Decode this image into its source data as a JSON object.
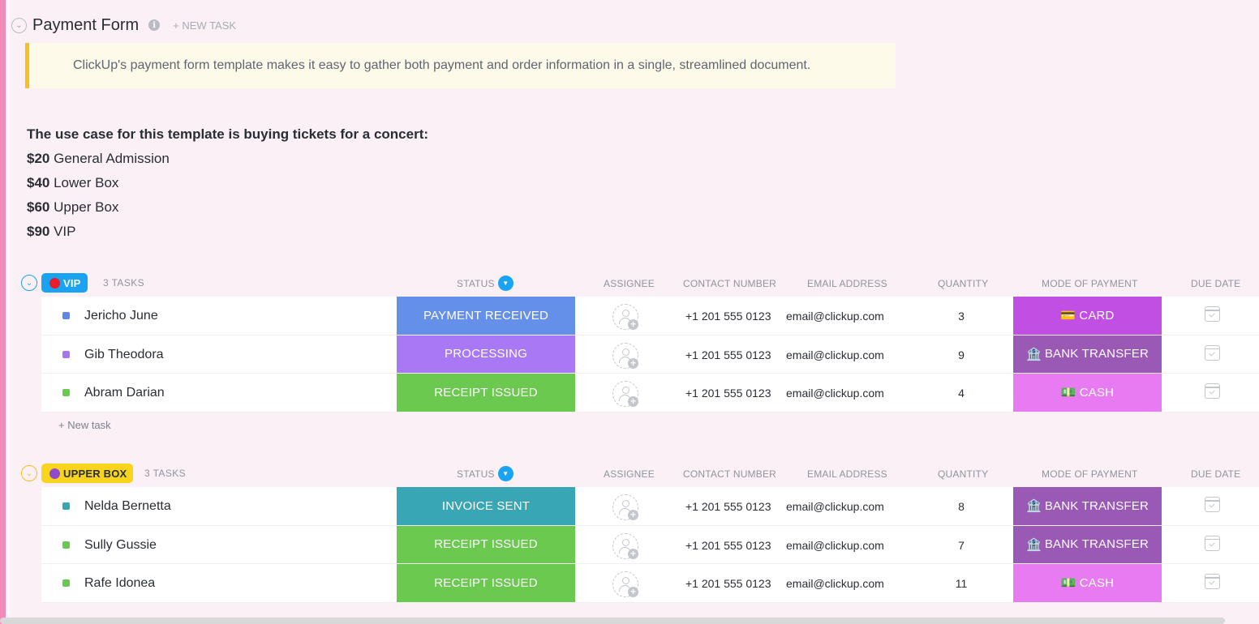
{
  "header": {
    "title": "Payment Form",
    "new_task": "+ NEW TASK"
  },
  "banner": {
    "text": "ClickUp's payment form template makes it easy to gather both payment and order information in a single, streamlined document."
  },
  "description": {
    "heading": "The use case for this template is buying tickets for a concert:",
    "items": [
      {
        "price": "$20",
        "label": " General Admission"
      },
      {
        "price": "$40",
        "label": " Lower Box"
      },
      {
        "price": "$60",
        "label": " Upper Box"
      },
      {
        "price": "$90",
        "label": " VIP"
      }
    ]
  },
  "columns": {
    "status": "STATUS",
    "assignee": "ASSIGNEE",
    "contact": "CONTACT NUMBER",
    "email": "EMAIL ADDRESS",
    "quantity": "QUANTITY",
    "payment": "MODE OF PAYMENT",
    "due": "DUE DATE"
  },
  "groups": [
    {
      "name": "VIP",
      "count": "3 TASKS",
      "badge_color": "#1aa3f0",
      "dot_color": "#e81c2b",
      "new_task": "+ New task",
      "rows": [
        {
          "name": "Jericho June",
          "square_color": "#5f87e8",
          "status": "PAYMENT RECEIVED",
          "status_color": "#6490ea",
          "contact": "+1 201 555 0123",
          "email": "email@clickup.com",
          "quantity": "3",
          "payment": "CARD",
          "payment_icon": "💳",
          "payment_color": "#c24fe3"
        },
        {
          "name": "Gib Theodora",
          "square_color": "#a875f0",
          "status": "PROCESSING",
          "status_color": "#a978f5",
          "contact": "+1 201 555 0123",
          "email": "email@clickup.com",
          "quantity": "9",
          "payment": "BANK TRANSFER",
          "payment_icon": "🏦",
          "payment_color": "#9b59b6"
        },
        {
          "name": "Abram Darian",
          "square_color": "#6bc950",
          "status": "RECEIPT ISSUED",
          "status_color": "#6bc950",
          "contact": "+1 201 555 0123",
          "email": "email@clickup.com",
          "quantity": "4",
          "payment": "CASH",
          "payment_icon": "💵",
          "payment_color": "#e97bf2"
        }
      ]
    },
    {
      "name": "UPPER BOX",
      "count": "3 TASKS",
      "badge_color": "#f8d51c",
      "dot_color": "#8e4bd0",
      "new_task": "+ New task",
      "rows": [
        {
          "name": "Nelda Bernetta",
          "square_color": "#36a6b5",
          "status": "INVOICE SENT",
          "status_color": "#38a6b5",
          "contact": "+1 201 555 0123",
          "email": "email@clickup.com",
          "quantity": "8",
          "payment": "BANK TRANSFER",
          "payment_icon": "🏦",
          "payment_color": "#9b59b6"
        },
        {
          "name": "Sully Gussie",
          "square_color": "#6bc950",
          "status": "RECEIPT ISSUED",
          "status_color": "#6bc950",
          "contact": "+1 201 555 0123",
          "email": "email@clickup.com",
          "quantity": "7",
          "payment": "BANK TRANSFER",
          "payment_icon": "🏦",
          "payment_color": "#9b59b6"
        },
        {
          "name": "Rafe Idonea",
          "square_color": "#6bc950",
          "status": "RECEIPT ISSUED",
          "status_color": "#6bc950",
          "contact": "+1 201 555 0123",
          "email": "email@clickup.com",
          "quantity": "11",
          "payment": "CASH",
          "payment_icon": "💵",
          "payment_color": "#e97bf2"
        }
      ]
    }
  ]
}
